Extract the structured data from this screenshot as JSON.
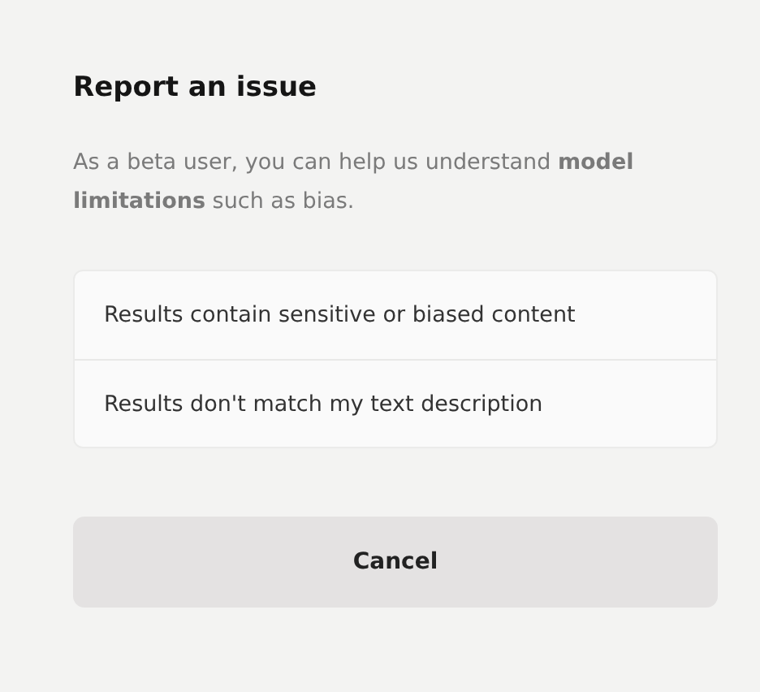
{
  "dialog": {
    "title": "Report an issue",
    "description": "As a beta user, you can help us understand **model limitations** such as bias.",
    "options": [
      {
        "label": "Results contain sensitive or biased content"
      },
      {
        "label": "Results don't match my text description"
      }
    ],
    "buttons": [
      "Cancel"
    ]
  }
}
